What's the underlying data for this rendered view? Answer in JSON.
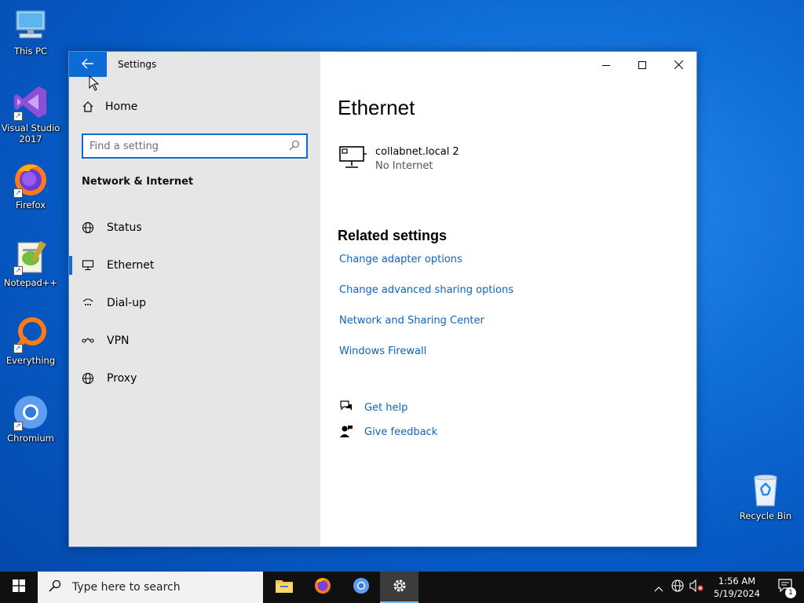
{
  "desktop": {
    "icons": [
      {
        "label": "This PC"
      },
      {
        "label": "Visual Studio 2017"
      },
      {
        "label": "Firefox"
      },
      {
        "label": "Notepad++"
      },
      {
        "label": "Everything"
      },
      {
        "label": "Chromium"
      },
      {
        "label": "Recycle Bin"
      }
    ]
  },
  "window": {
    "title": "Settings",
    "home_label": "Home",
    "search_placeholder": "Find a setting",
    "section_label": "Network & Internet",
    "nav": [
      {
        "label": "Status"
      },
      {
        "label": "Ethernet"
      },
      {
        "label": "Dial-up"
      },
      {
        "label": "VPN"
      },
      {
        "label": "Proxy"
      }
    ]
  },
  "main": {
    "title": "Ethernet",
    "network": {
      "name": "collabnet.local 2",
      "status": "No Internet"
    },
    "related_heading": "Related settings",
    "links": [
      "Change adapter options",
      "Change advanced sharing options",
      "Network and Sharing Center",
      "Windows Firewall"
    ],
    "help": {
      "get_help": "Get help",
      "feedback": "Give feedback"
    }
  },
  "taskbar": {
    "search_placeholder": "Type here to search",
    "time": "1:56 AM",
    "date": "5/19/2024",
    "notification_count": "1"
  },
  "colors": {
    "accent": "#0c6cd4",
    "link": "#0b64c6",
    "sidebar": "#e6e6e6",
    "taskbar": "#101010"
  }
}
